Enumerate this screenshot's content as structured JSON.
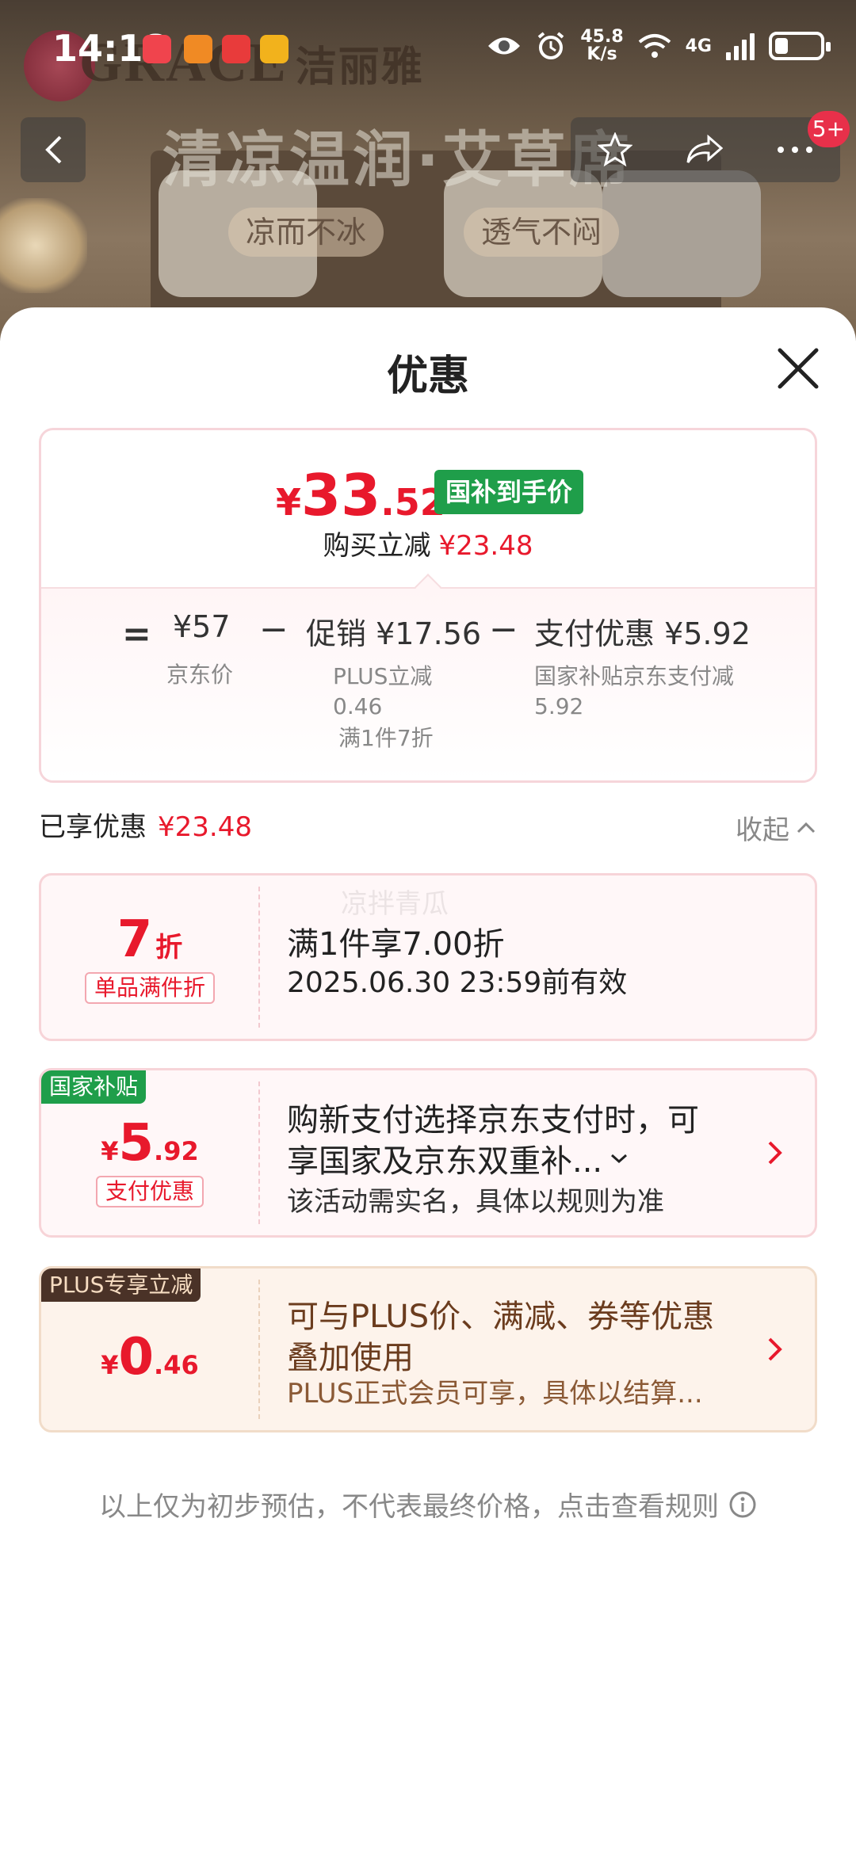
{
  "status_bar": {
    "time": "14:18",
    "net_speed_value": "45.8",
    "net_speed_unit": "K/s",
    "network": "4G",
    "battery_level": 0.3,
    "icons": [
      "eye-icon",
      "alarm-icon",
      "wifi-icon",
      "signal-icon",
      "battery-icon"
    ]
  },
  "banner": {
    "brand_logo": "GRACE",
    "brand_cn": "洁丽雅",
    "title": "清凉温润·艾草席",
    "tags": [
      "凉而不冰",
      "透气不闷"
    ],
    "notification_badge": "5+"
  },
  "sheet": {
    "title": "优惠"
  },
  "summary": {
    "price_yen": "¥",
    "price_int": "33",
    "price_dec": ".52",
    "badge": "国补到手价",
    "buy_reduce_label": "购买立减",
    "buy_reduce_amount": "¥23.48",
    "eq": "=",
    "jd_price": "¥57",
    "jd_price_label": "京东价",
    "minus": "−",
    "promo": "促销 ¥17.56",
    "promo_note_1": "PLUS立减",
    "promo_note_2": "0.46",
    "promo_note_3": "满1件7折",
    "pay": "支付优惠 ¥5.92",
    "pay_note": "国家补贴京东支付减5.92"
  },
  "enjoyed": {
    "label": "已享优惠",
    "amount": "¥23.48",
    "collapse_label": "收起"
  },
  "offers": [
    {
      "big": "7",
      "unit": "折",
      "pill": "单品满件折",
      "line1": "满1件享7.00折",
      "line2": "2025.06.30 23:59前有效",
      "ghost": "凉拌青瓜"
    },
    {
      "tag": "国家补贴",
      "yen": "¥",
      "int": "5",
      "dec": ".92",
      "pill": "支付优惠",
      "line1": "购新支付选择京东支付时，可",
      "line2": "享国家及京东双重补...",
      "line3": "该活动需实名，具体以规则为准"
    },
    {
      "tag": "PLUS专享立减",
      "yen": "¥",
      "int": "0",
      "dec": ".46",
      "line1": "可与PLUS价、满减、券等优惠",
      "line2": "叠加使用",
      "line3": "PLUS正式会员可享，具体以结算..."
    }
  ],
  "disclaimer": "以上仅为初步预估，不代表最终价格，点击查看规则",
  "colors": {
    "price_red": "#e8192c",
    "subsidy_green": "#1f9e4a",
    "plus_dark": "#4a3227"
  }
}
